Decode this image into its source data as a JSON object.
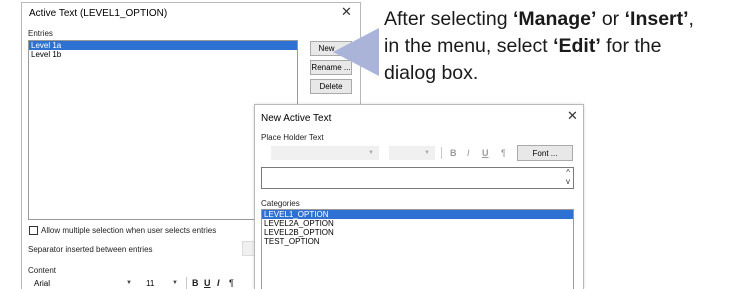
{
  "dialog1": {
    "title": "Active Text (LEVEL1_OPTION)",
    "close_glyph": "✕",
    "entries_label": "Entries",
    "entries": [
      "Level 1a",
      "Level 1b"
    ],
    "selected_entry_index": 0,
    "buttons": {
      "new": "New ...",
      "rename": "Rename ...",
      "delete": "Delete"
    },
    "allow_multiple_label": "Allow multiple selection when user selects entries",
    "allow_multiple_checked": false,
    "separator_label": "Separator inserted between entries",
    "content_label": "Content",
    "font": "Arial",
    "font_size": "11",
    "format_buttons": [
      "B",
      "U",
      "I",
      "¶"
    ]
  },
  "annotation": {
    "line1_a": "After selecting ",
    "manage": "‘Manage’",
    "or": " or ",
    "insert": "‘Insert’",
    "line1_end": ",",
    "line2_a": "in the menu, select ",
    "edit": "‘Edit’",
    "line2_b": " for the",
    "line3": "dialog box.",
    "pointer_color": "#aab4d8"
  },
  "dialog2": {
    "title": "New Active Text",
    "close_glyph": "✕",
    "placeholder_label": "Place Holder Text",
    "format_buttons": [
      "B",
      "I",
      "U",
      "¶"
    ],
    "font_button": "Font ...",
    "categories_label": "Categories",
    "categories": [
      "LEVEL1_OPTION",
      "LEVEL2A_OPTION",
      "LEVEL2B_OPTION",
      "TEST_OPTION"
    ],
    "selected_category_index": 0,
    "selection_color": "#2d72d2"
  }
}
